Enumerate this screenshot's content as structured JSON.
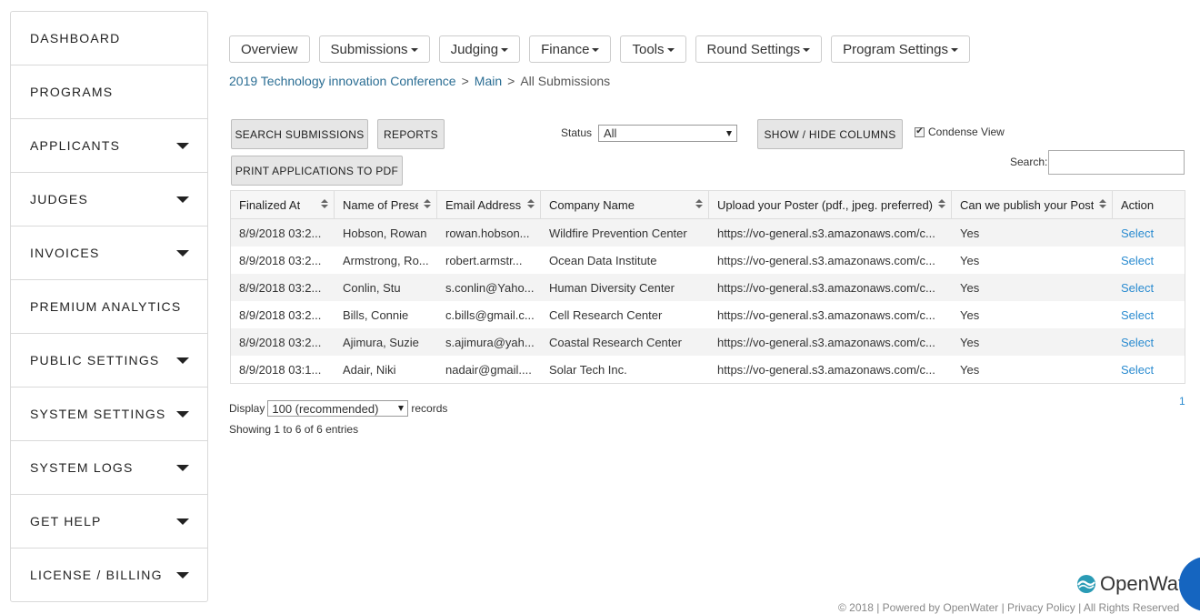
{
  "sidebar": {
    "items": [
      {
        "label": "DASHBOARD",
        "expandable": false
      },
      {
        "label": "PROGRAMS",
        "expandable": false
      },
      {
        "label": "APPLICANTS",
        "expandable": true
      },
      {
        "label": "JUDGES",
        "expandable": true
      },
      {
        "label": "INVOICES",
        "expandable": true
      },
      {
        "label": "PREMIUM ANALYTICS",
        "expandable": false
      },
      {
        "label": "PUBLIC SETTINGS",
        "expandable": true
      },
      {
        "label": "SYSTEM SETTINGS",
        "expandable": true
      },
      {
        "label": "SYSTEM LOGS",
        "expandable": true
      },
      {
        "label": "GET HELP",
        "expandable": true
      },
      {
        "label": "LICENSE / BILLING",
        "expandable": true
      }
    ]
  },
  "topnav": {
    "items": [
      {
        "label": "Overview",
        "dropdown": false
      },
      {
        "label": "Submissions",
        "dropdown": true
      },
      {
        "label": "Judging",
        "dropdown": true
      },
      {
        "label": "Finance",
        "dropdown": true
      },
      {
        "label": "Tools",
        "dropdown": true
      },
      {
        "label": "Round Settings",
        "dropdown": true
      },
      {
        "label": "Program Settings",
        "dropdown": true
      }
    ]
  },
  "breadcrumb": {
    "program": "2019 Technology innovation Conference",
    "section": "Main",
    "current": "All Submissions",
    "separator": ">"
  },
  "toolbar": {
    "search_submissions": "SEARCH SUBMISSIONS",
    "reports": "REPORTS",
    "print_pdf": "PRINT APPLICATIONS TO PDF",
    "status_label": "Status",
    "status_value": "All",
    "show_hide_columns": "SHOW / HIDE COLUMNS",
    "condense_label": "Condense View",
    "condense_checked": true,
    "checkmark": "✔",
    "search_label": "Search:",
    "search_value": ""
  },
  "table": {
    "columns": [
      "Finalized At",
      "Name of Prese...",
      "Email Address",
      "Company Name",
      "Upload your Poster (pdf., jpeg. preferred)",
      "Can we publish your Poste...",
      "Action"
    ],
    "rows": [
      {
        "finalized": "8/9/2018 03:2...",
        "name": "Hobson, Rowan",
        "email": "rowan.hobson...",
        "company": "Wildfire Prevention Center",
        "poster": "https://vo-general.s3.amazonaws.com/c...",
        "publish": "Yes",
        "action": "Select"
      },
      {
        "finalized": "8/9/2018 03:2...",
        "name": "Armstrong, Ro...",
        "email": "robert.armstr...",
        "company": "Ocean Data Institute",
        "poster": "https://vo-general.s3.amazonaws.com/c...",
        "publish": "Yes",
        "action": "Select"
      },
      {
        "finalized": "8/9/2018 03:2...",
        "name": "Conlin, Stu",
        "email": "s.conlin@Yaho...",
        "company": "Human Diversity Center",
        "poster": "https://vo-general.s3.amazonaws.com/c...",
        "publish": "Yes",
        "action": "Select"
      },
      {
        "finalized": "8/9/2018 03:2...",
        "name": "Bills, Connie",
        "email": "c.bills@gmail.c...",
        "company": "Cell Research Center",
        "poster": "https://vo-general.s3.amazonaws.com/c...",
        "publish": "Yes",
        "action": "Select"
      },
      {
        "finalized": "8/9/2018 03:2...",
        "name": "Ajimura, Suzie",
        "email": "s.ajimura@yah...",
        "company": "Coastal Research Center",
        "poster": "https://vo-general.s3.amazonaws.com/c...",
        "publish": "Yes",
        "action": "Select"
      },
      {
        "finalized": "8/9/2018 03:1...",
        "name": "Adair, Niki",
        "email": "nadair@gmail....",
        "company": "Solar Tech Inc.",
        "poster": "https://vo-general.s3.amazonaws.com/c...",
        "publish": "Yes",
        "action": "Select"
      }
    ]
  },
  "footer": {
    "display_label": "Display",
    "display_value": "100 (recommended)",
    "records_label": "records",
    "showing": "Showing 1 to 6 of 6 entries",
    "page": "1",
    "brand": "OpenWat",
    "copyright": "© 2018 | Powered by OpenWater | Privacy Policy | All Rights Reserved"
  },
  "colors": {
    "link": "#2a8bd0",
    "breadcrumb_link": "#2a6d93",
    "chat_bubble": "#1565c0",
    "brand_teal": "#2a9bb5"
  }
}
